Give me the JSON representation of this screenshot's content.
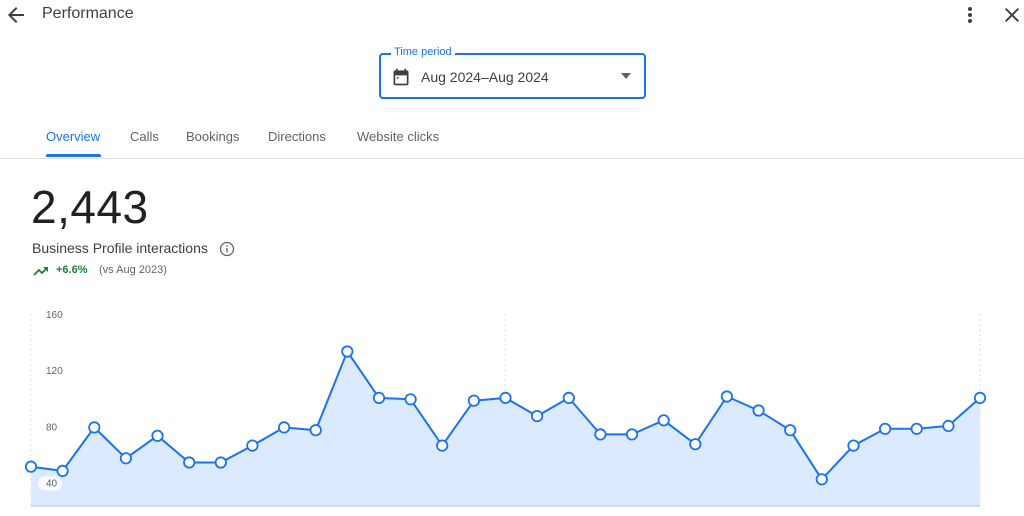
{
  "header": {
    "title": "Performance",
    "icons": {
      "back": "arrow-back-icon",
      "more": "more-vert-icon",
      "close": "close-icon"
    }
  },
  "time_period": {
    "label": "Time period",
    "value": "Aug 2024–Aug 2024",
    "icons": {
      "calendar": "calendar-icon",
      "dropdown": "arrow-drop-down-icon"
    }
  },
  "tabs": [
    {
      "label": "Overview",
      "active": true
    },
    {
      "label": "Calls",
      "active": false
    },
    {
      "label": "Bookings",
      "active": false
    },
    {
      "label": "Directions",
      "active": false
    },
    {
      "label": "Website clicks",
      "active": false
    }
  ],
  "summary": {
    "total": "2,443",
    "label": "Business Profile interactions",
    "change": "+6.6%",
    "comparison": "(vs Aug 2023)"
  },
  "colors": {
    "accent": "#1a73e8",
    "positive": "#188038",
    "area_fill": "#dbeafe",
    "text": "#202124"
  },
  "chart_data": {
    "type": "line",
    "ylim": [
      24,
      160
    ],
    "yticks": [
      40,
      80,
      120,
      160
    ],
    "grid": "vertical dashed",
    "series": [
      {
        "values": [
          52,
          49,
          80,
          58,
          74,
          55,
          55,
          67,
          80,
          78,
          134,
          101,
          100,
          67,
          99,
          101,
          88,
          101,
          75,
          75,
          85,
          68,
          102,
          92,
          78,
          43,
          67,
          79,
          79,
          81,
          101
        ]
      }
    ]
  }
}
